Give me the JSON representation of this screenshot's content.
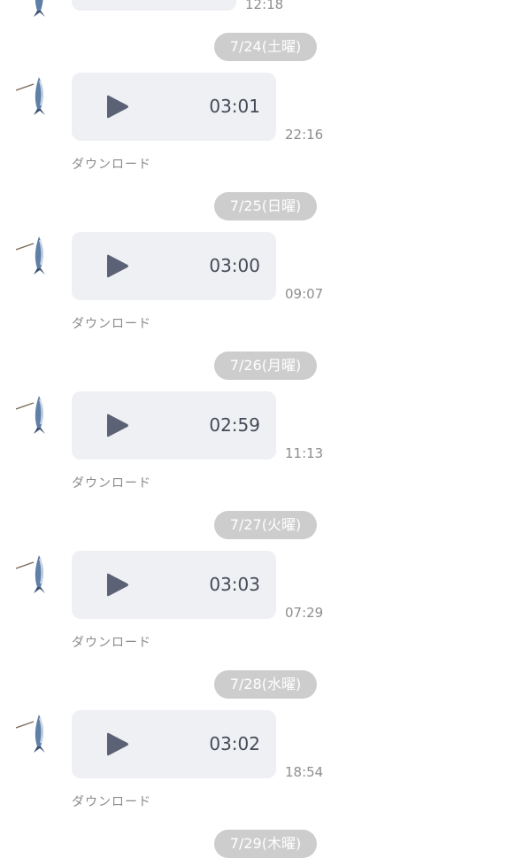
{
  "top": {
    "time": "12:18"
  },
  "messages": [
    {
      "date": "7/24(土曜)",
      "duration": "03:01",
      "time": "22:16",
      "download": "ダウンロード"
    },
    {
      "date": "7/25(日曜)",
      "duration": "03:00",
      "time": "09:07",
      "download": "ダウンロード"
    },
    {
      "date": "7/26(月曜)",
      "duration": "02:59",
      "time": "11:13",
      "download": "ダウンロード"
    },
    {
      "date": "7/27(火曜)",
      "duration": "03:03",
      "time": "07:29",
      "download": "ダウンロード"
    },
    {
      "date": "7/28(水曜)",
      "duration": "03:02",
      "time": "18:54",
      "download": "ダウンロード"
    }
  ],
  "next_date": "7/29(木曜)",
  "icons": {
    "avatar": "fish-avatar-icon",
    "play": "play-icon"
  },
  "colors": {
    "bubble": "#eff0f3",
    "date_pill": "#cdcdcd",
    "play": "#5c6275"
  }
}
